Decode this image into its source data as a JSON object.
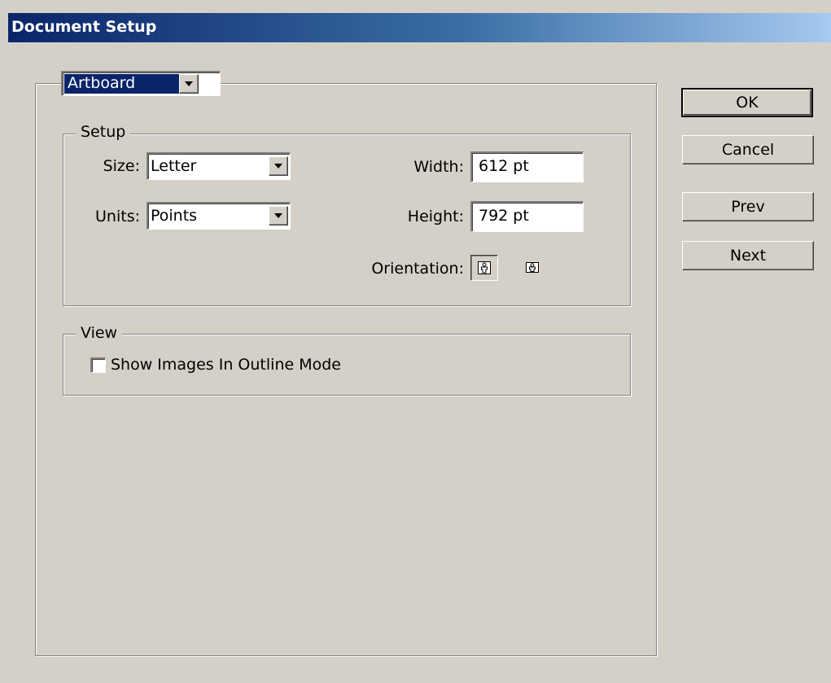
{
  "window": {
    "title": "Document Setup"
  },
  "mode_select": {
    "value": "Artboard"
  },
  "setup": {
    "legend": "Setup",
    "size_label": "Size:",
    "size_value": "Letter",
    "units_label": "Units:",
    "units_value": "Points",
    "width_label": "Width:",
    "width_value": "612 pt",
    "height_label": "Height:",
    "height_value": "792 pt",
    "orientation_label": "Orientation:",
    "orientation_selected": "portrait",
    "portrait_icon": "portrait-orientation-icon",
    "landscape_icon": "landscape-orientation-icon"
  },
  "view": {
    "legend": "View",
    "show_images_label": "Show Images In Outline Mode",
    "show_images_checked": false
  },
  "buttons": {
    "ok": "OK",
    "cancel": "Cancel",
    "prev": "Prev",
    "next": "Next"
  },
  "colors": {
    "dialog_bg": "#d4d0c8",
    "title_gradient_start": "#0a246a",
    "title_gradient_end": "#a6caf0",
    "selection": "#0a246a"
  }
}
